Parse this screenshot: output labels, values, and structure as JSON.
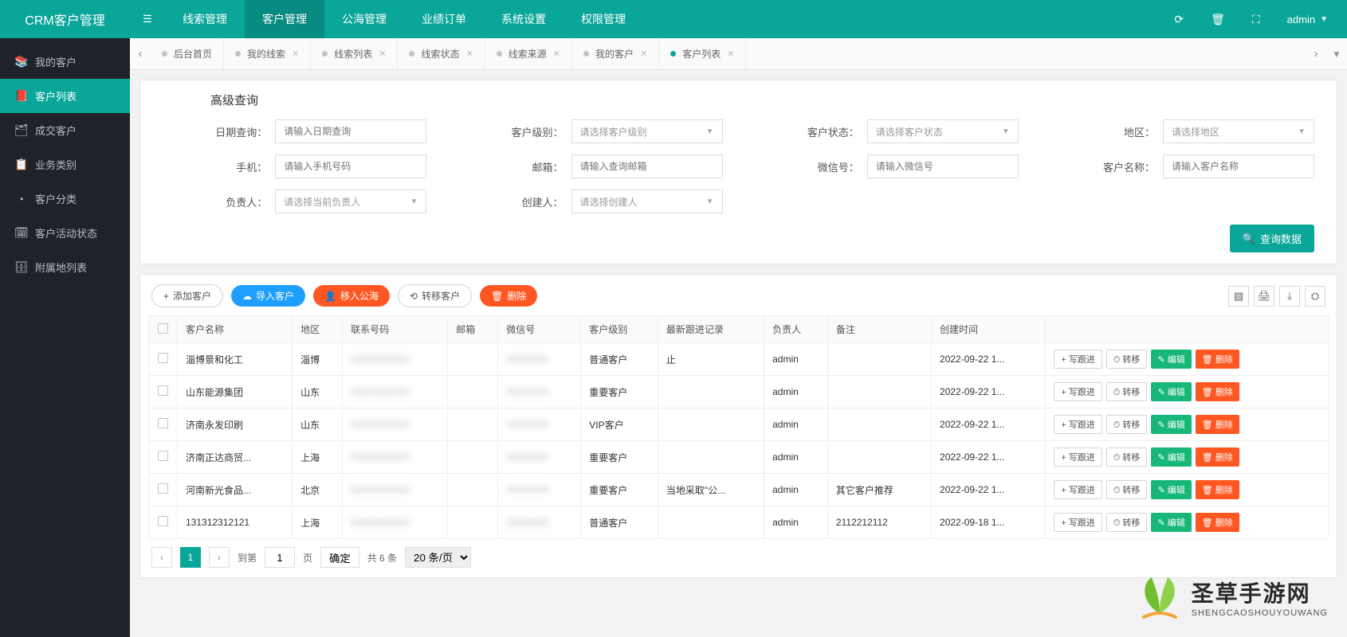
{
  "app_title": "CRM客户管理",
  "top_nav": [
    "线索管理",
    "客户管理",
    "公海管理",
    "业绩订单",
    "系统设置",
    "权限管理"
  ],
  "top_nav_active_index": 1,
  "user": "admin",
  "sidebar": [
    {
      "icon": "📚",
      "label": "我的客户"
    },
    {
      "icon": "📕",
      "label": "客户列表"
    },
    {
      "icon": "🗂",
      "label": "成交客户"
    },
    {
      "icon": "📋",
      "label": "业务类别"
    },
    {
      "icon": "◔",
      "label": "客户分类"
    },
    {
      "icon": "🗓",
      "label": "客户活动状态"
    },
    {
      "icon": "🗄",
      "label": "附属地列表"
    }
  ],
  "sidebar_active_index": 1,
  "page_tabs": [
    {
      "label": "后台首页",
      "closable": false
    },
    {
      "label": "我的线索",
      "closable": true
    },
    {
      "label": "线索列表",
      "closable": true
    },
    {
      "label": "线索状态",
      "closable": true
    },
    {
      "label": "线索来源",
      "closable": true
    },
    {
      "label": "我的客户",
      "closable": true
    },
    {
      "label": "客户列表",
      "closable": true
    }
  ],
  "page_tab_active_index": 6,
  "search": {
    "title": "高级查询",
    "fields": {
      "date": {
        "label": "日期查询：",
        "placeholder": "请输入日期查询",
        "type": "input"
      },
      "level": {
        "label": "客户级别：",
        "placeholder": "请选择客户级别",
        "type": "select"
      },
      "status": {
        "label": "客户状态：",
        "placeholder": "请选择客户状态",
        "type": "select"
      },
      "area": {
        "label": "地区：",
        "placeholder": "请选择地区",
        "type": "select"
      },
      "phone": {
        "label": "手机：",
        "placeholder": "请输入手机号码",
        "type": "input"
      },
      "email": {
        "label": "邮箱：",
        "placeholder": "请输入查询邮箱",
        "type": "input"
      },
      "wechat": {
        "label": "微信号：",
        "placeholder": "请输入微信号",
        "type": "input"
      },
      "name": {
        "label": "客户名称：",
        "placeholder": "请输入客户名称",
        "type": "input"
      },
      "owner": {
        "label": "负责人：",
        "placeholder": "请选择当前负责人",
        "type": "select"
      },
      "creator": {
        "label": "创建人：",
        "placeholder": "请选择创建人",
        "type": "select"
      }
    },
    "query_button": "查询数据"
  },
  "toolbar": {
    "add": "添加客户",
    "import": "导入客户",
    "move_sea": "移入公海",
    "transfer": "转移客户",
    "delete": "删除"
  },
  "table": {
    "headers": [
      "客户名称",
      "地区",
      "联系号码",
      "邮箱",
      "微信号",
      "客户级别",
      "最新跟进记录",
      "负责人",
      "备注",
      "创建时间"
    ],
    "rows": [
      {
        "name": "淄博景和化工",
        "area": "淄博",
        "phone": "——",
        "email": "",
        "wechat": "——",
        "level": "普通客户",
        "follow": "止",
        "owner": "admin",
        "remark": "",
        "created": "2022-09-22 1..."
      },
      {
        "name": "山东能源集团",
        "area": "山东",
        "phone": "——",
        "email": "",
        "wechat": "——",
        "level": "重要客户",
        "follow": "",
        "owner": "admin",
        "remark": "",
        "created": "2022-09-22 1..."
      },
      {
        "name": "济南永发印刷",
        "area": "山东",
        "phone": "——",
        "email": "",
        "wechat": "——",
        "level": "VIP客户",
        "follow": "",
        "owner": "admin",
        "remark": "",
        "created": "2022-09-22 1..."
      },
      {
        "name": "济南正达商贸...",
        "area": "上海",
        "phone": "——",
        "email": "",
        "wechat": "——",
        "level": "重要客户",
        "follow": "",
        "owner": "admin",
        "remark": "",
        "created": "2022-09-22 1..."
      },
      {
        "name": "河南新光食品...",
        "area": "北京",
        "phone": "——",
        "email": "",
        "wechat": "——",
        "level": "重要客户",
        "follow": "当地采取\"公...",
        "owner": "admin",
        "remark": "其它客户推荐",
        "created": "2022-09-22 1..."
      },
      {
        "name": "131312312121",
        "area": "上海",
        "phone": "——",
        "email": "",
        "wechat": "——",
        "level": "普通客户",
        "follow": "",
        "owner": "admin",
        "remark": "2112212112",
        "created": "2022-09-18 1..."
      }
    ],
    "row_actions": {
      "write_follow": "写跟进",
      "transfer": "转移",
      "edit": "编辑",
      "delete": "删除"
    }
  },
  "pagination": {
    "to_page_label": "到第",
    "page_unit": "页",
    "confirm": "确定",
    "total_label": "共 6 条",
    "current_page": "1",
    "page_size_label": "20 条/页"
  },
  "watermark": {
    "title": "圣草手游网",
    "sub": "SHENGCAOSHOUYOUWANG"
  }
}
